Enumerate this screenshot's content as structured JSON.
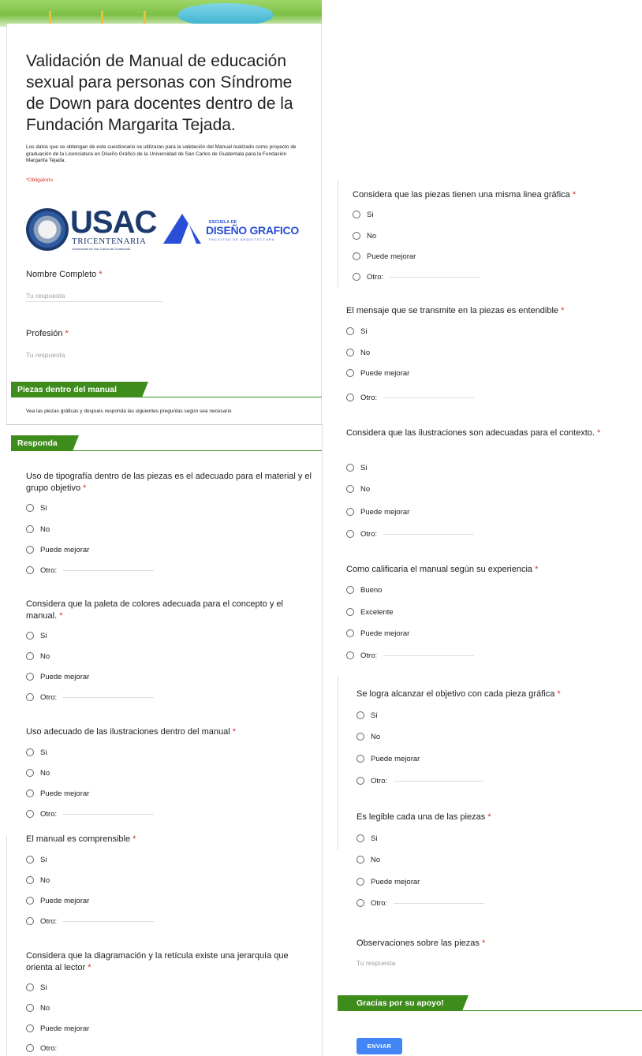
{
  "form": {
    "title": "Validación de Manual de educación sexual para personas con Síndrome de Down para docentes dentro de la Fundación Margarita Tejada.",
    "description": "Los datos que se obtengan de este cuestionario se utilizaran para la validación del Manual realizado como proyecto de graduación de la Licenciatura en Diseño Gráfico de la Universidad de San Carlos de Guatemala para la Fundación Margarita Tejada.",
    "required_note": "*Obligatorio",
    "required_mark": "*",
    "placeholder": "Tu respuesta",
    "submit_label": "ENVIAR"
  },
  "logos": {
    "usac_word": "USAC",
    "usac_sub": "TRICENTENARIA",
    "usac_line": "Universidad de San Carlos de Guatemala",
    "dg_small": "ESCUELA DE",
    "dg_word": "DISEÑO GRAFICO",
    "dg_tag": "FACULTAD DE ARQUITECTURA"
  },
  "fields": {
    "nombre": "Nombre Completo",
    "profesion": "Profesión"
  },
  "sections": {
    "piezas": {
      "title": "Piezas dentro del manual",
      "description": "Vea las piezas gráficas y después responda las siguientes preguntas según sea necesario"
    },
    "responda": {
      "title": "Responda"
    },
    "gracias": {
      "title": "Gracias por su apoyo!"
    }
  },
  "options": {
    "si": "Si",
    "no": "No",
    "puede": "Puede mejorar",
    "otro": "Otro:",
    "bueno": "Bueno",
    "excelente": "Excelente"
  },
  "questions": {
    "q1": "Uso de tipografía dentro de las piezas es el adecuado para el material y el grupo objetivo",
    "q2": "Considera que la paleta de colores adecuada para el concepto y el manual.",
    "q3": "Uso adecuado de las ilustraciones dentro del manual",
    "q4": "El manual es comprensible",
    "q5": "Considera que la diagramación y la retícula existe una jerarquía que orienta al lector",
    "q6": "Considera que las piezas tienen una misma linea gráfica",
    "q7": "El mensaje que se transmite en la piezas es entendible",
    "q8": "Considera que las ilustraciones son adecuadas para el contexto.",
    "q9": "Como calificaria el manual según su experiencia",
    "q10": "Se logra alcanzar el objetivo con cada pieza gráfica",
    "q11": "Es legible cada una de las piezas",
    "q12": "Observaciones sobre las piezas"
  },
  "colors": {
    "section_green": "#3d8c1c",
    "required_red": "#d93025",
    "submit_blue": "#4285f4"
  }
}
